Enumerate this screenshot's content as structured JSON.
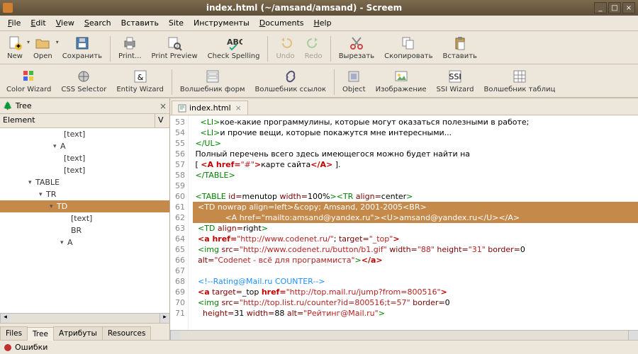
{
  "window": {
    "title": "index.html (~/amsand/amsand) - Screem"
  },
  "menu": [
    "File",
    "Edit",
    "View",
    "Search",
    "Вставить",
    "Site",
    "Инструменты",
    "Documents",
    "Help"
  ],
  "menu_ul": [
    "F",
    "E",
    "V",
    "S",
    "",
    "",
    "",
    "D",
    "H"
  ],
  "toolbar1": [
    {
      "label": "New",
      "icon": "file-new",
      "drop": true
    },
    {
      "label": "Open",
      "icon": "folder-open",
      "drop": true
    },
    {
      "label": "Сохранить",
      "icon": "save"
    },
    {
      "sep": true
    },
    {
      "label": "Print...",
      "icon": "printer"
    },
    {
      "label": "Print Preview",
      "icon": "print-preview"
    },
    {
      "label": "Check Spelling",
      "icon": "spellcheck"
    },
    {
      "sep": true
    },
    {
      "label": "Undo",
      "icon": "undo",
      "disabled": true
    },
    {
      "label": "Redo",
      "icon": "redo",
      "disabled": true
    },
    {
      "sep": true
    },
    {
      "label": "Вырезать",
      "icon": "cut"
    },
    {
      "label": "Скопировать",
      "icon": "copy"
    },
    {
      "label": "Вставить",
      "icon": "paste"
    }
  ],
  "toolbar2": [
    {
      "label": "Color Wizard",
      "icon": "color-wizard"
    },
    {
      "label": "CSS Selector",
      "icon": "css-selector"
    },
    {
      "label": "Entity Wizard",
      "icon": "entity-wizard"
    },
    {
      "sep": true
    },
    {
      "label": "Волшебник форм",
      "icon": "form-wizard"
    },
    {
      "label": "Волшебник ссылок",
      "icon": "link-wizard"
    },
    {
      "sep": true
    },
    {
      "label": "Object",
      "icon": "object"
    },
    {
      "label": "Изображение",
      "icon": "image-wizard"
    },
    {
      "label": "SSI Wizard",
      "icon": "ssi-wizard"
    },
    {
      "label": "Волшебник таблиц",
      "icon": "table-wizard"
    }
  ],
  "sidebar": {
    "title": "Tree",
    "col1": "Element",
    "col2": "V",
    "nodes": [
      {
        "label": "[text]",
        "indent": 90
      },
      {
        "label": "A",
        "indent": 75,
        "exp": true
      },
      {
        "label": "[text]",
        "indent": 90
      },
      {
        "label": "[text]",
        "indent": 90
      },
      {
        "label": "TABLE",
        "indent": 40,
        "exp": true
      },
      {
        "label": "TR",
        "indent": 55,
        "exp": true
      },
      {
        "label": "TD",
        "indent": 70,
        "exp": true,
        "sel": true
      },
      {
        "label": "[text]",
        "indent": 100
      },
      {
        "label": "BR",
        "indent": 100
      },
      {
        "label": "A",
        "indent": 85,
        "exp": true
      }
    ],
    "tabs": [
      "Files",
      "Tree",
      "Атрибуты",
      "Resources"
    ],
    "active_tab": 1
  },
  "editor": {
    "filename": "index.html",
    "first_line": 53,
    "sel_start": 61,
    "sel_end": 62,
    "lines": [
      {
        "n": 53,
        "html": "   <span class='t-tag'>&lt;LI&gt;</span>кое-какие программулины, которые могут оказаться полезными в работе;"
      },
      {
        "n": 54,
        "html": "   <span class='t-tag'>&lt;LI&gt;</span>и прочие вещи, которые покажутся мне интересными..."
      },
      {
        "n": 55,
        "html": " <span class='t-tag'>&lt;/UL&gt;</span>"
      },
      {
        "n": 56,
        "html": " Полный перечень всего здесь имеющегося можно будет найти на"
      },
      {
        "n": 57,
        "html": " [ <span class='t-link'>&lt;A href=</span><span class='t-str'>\"#\"</span><span class='t-link'>&gt;</span>карте сайта<span class='t-link'>&lt;/A&gt;</span> ]."
      },
      {
        "n": 58,
        "html": " <span class='t-tag'>&lt;/TABLE&gt;</span>"
      },
      {
        "n": 59,
        "html": ""
      },
      {
        "n": 60,
        "html": " <span class='t-tag'>&lt;TABLE</span> <span class='t-attr'>id</span><span class='t-op'>=</span>menutop <span class='t-attr'>width</span><span class='t-op'>=</span>100%<span class='t-tag'>&gt;&lt;TR</span> <span class='t-attr'>align</span><span class='t-op'>=</span>center<span class='t-tag'>&gt;</span>"
      },
      {
        "n": 61,
        "html": "  &lt;TD nowrap align=left&gt;&amp;copy; Amsand, 2001-2005&lt;BR&gt;"
      },
      {
        "n": 62,
        "html": "             &lt;A href=\"mailto:amsand@yandex.ru\"&gt;&lt;U&gt;amsand@yandex.ru&lt;/U&gt;&lt;/A&gt;"
      },
      {
        "n": 63,
        "html": "  <span class='t-tag'>&lt;TD</span> <span class='t-attr'>align</span><span class='t-op'>=</span>right<span class='t-tag'>&gt;</span>"
      },
      {
        "n": 64,
        "html": "  <span class='t-link'>&lt;a href=</span><span class='t-str'>\"http://www.codenet.ru/\"</span>; <span class='t-attr'>target</span><span class='t-op'>=</span><span class='t-str'>\"_top\"</span><span class='t-link'>&gt;</span>"
      },
      {
        "n": 65,
        "html": "  <span class='t-tag'>&lt;img</span> <span class='t-attr'>src</span><span class='t-op'>=</span><span class='t-str'>\"http://www.codenet.ru/button/b1.gif\"</span> <span class='t-attr'>width</span><span class='t-op'>=</span><span class='t-str'>\"88\"</span> <span class='t-attr'>height</span><span class='t-op'>=</span><span class='t-str'>\"31\"</span> <span class='t-attr'>border</span><span class='t-op'>=</span>0"
      },
      {
        "n": 66,
        "html": "  <span class='t-attr'>alt</span><span class='t-op'>=</span><span class='t-str'>\"Codenet - всё для программиста\"</span><span class='t-tag'>&gt;</span><span class='t-link'>&lt;/a&gt;</span>"
      },
      {
        "n": 67,
        "html": ""
      },
      {
        "n": 68,
        "html": "  <span class='t-cmt'>&lt;!--Rating@Mail.ru COUNTER--&gt;</span>"
      },
      {
        "n": 69,
        "html": "  <span class='t-link'>&lt;a</span> <span class='t-attr'>target</span><span class='t-op'>=</span>_top <span class='t-link'>href=</span><span class='t-str'>\"http://top.mail.ru/jump?from=800516\"</span><span class='t-link'>&gt;</span>"
      },
      {
        "n": 70,
        "html": "  <span class='t-tag'>&lt;img</span> <span class='t-attr'>src</span><span class='t-op'>=</span><span class='t-str'>\"http://top.list.ru/counter?id=800516;t=57\"</span> <span class='t-attr'>border</span><span class='t-op'>=</span>0"
      },
      {
        "n": 71,
        "html": "    <span class='t-attr'>height</span><span class='t-op'>=</span>31 <span class='t-attr'>width</span><span class='t-op'>=</span>88 <span class='t-attr'>alt</span><span class='t-op'>=</span><span class='t-str'>\"Рейтинг@Mail.ru\"</span><span class='t-tag'>&gt;</span>"
      }
    ]
  },
  "status": {
    "label": "Ошибки"
  }
}
